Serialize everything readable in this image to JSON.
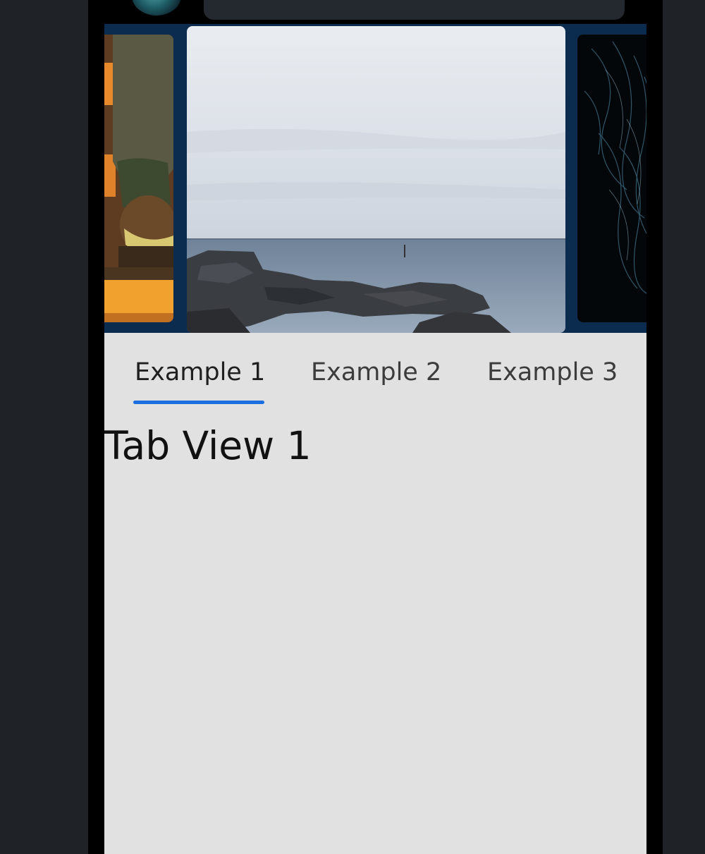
{
  "tabs": [
    {
      "label": "Example 1",
      "active": true
    },
    {
      "label": "Example 2",
      "active": false
    },
    {
      "label": "Example 3",
      "active": false
    }
  ],
  "tab_view": {
    "title": "Tab View 1"
  },
  "colors": {
    "accent": "#1a6ee0",
    "content_background": "#e1e1e1",
    "carousel_background": "#0b2b4f",
    "frame": "#000000",
    "page_background": "#1f2327"
  },
  "carousel": {
    "items": [
      {
        "name": "stairs-photo",
        "position": "left"
      },
      {
        "name": "rocky-coast-photo",
        "position": "center"
      },
      {
        "name": "dark-abstract-photo",
        "position": "right"
      }
    ]
  }
}
